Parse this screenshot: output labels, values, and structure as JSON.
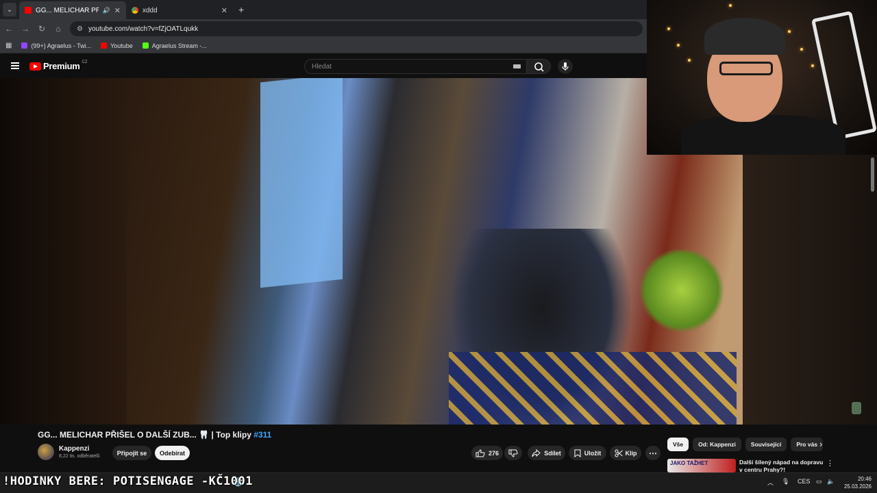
{
  "browser": {
    "tabs": [
      {
        "title": "GG... MELICHAR PŘIŠEL O D",
        "active": true,
        "favicon_color": "#ff0000"
      },
      {
        "title": "xddd",
        "active": false,
        "favicon_color": "#8ab4f8"
      }
    ],
    "url": "youtube.com/watch?v=fZjOATLqukk",
    "bookmarks": [
      {
        "label": "(99+) Agraelus - Twi...",
        "color": "#9146ff"
      },
      {
        "label": "Youtube",
        "color": "#ff0000"
      },
      {
        "label": "Agraelus Stream -...",
        "color": "#53fc18"
      }
    ]
  },
  "youtube": {
    "logo_text": "Premium",
    "logo_country": "CZ",
    "search_placeholder": "Hledat"
  },
  "video": {
    "title": "GG... MELICHAR PŘIŠEL O DALŠÍ ZUB... 🦷 | Top klipy",
    "hashtag": "#311",
    "channel_name": "Kappenzi",
    "subscribers": "8,22 tis. odběratelů",
    "join_label": "Připojit se",
    "subscribe_label": "Odebírat",
    "likes": "276",
    "share_label": "Sdílet",
    "save_label": "Uložit",
    "clip_label": "Klip"
  },
  "sidebar": {
    "chips": [
      "Vše",
      "Od: Kappenzi",
      "Související",
      "Pro vás"
    ],
    "recommendation": {
      "title": "Další šílený nápad na dopravu v centru Prahy?!",
      "thumb_text": "JAKO TAŽHET"
    }
  },
  "overlay": {
    "ticker": "!HODINKY BERE: POTISENGAGE -KČ1001"
  },
  "taskbar": {
    "lang": "CES",
    "time": "20:46",
    "date": "25.03.2026"
  },
  "colors": {
    "brand": "#ff0000",
    "link": "#3ea6ff",
    "bg": "#0f0f0f"
  }
}
